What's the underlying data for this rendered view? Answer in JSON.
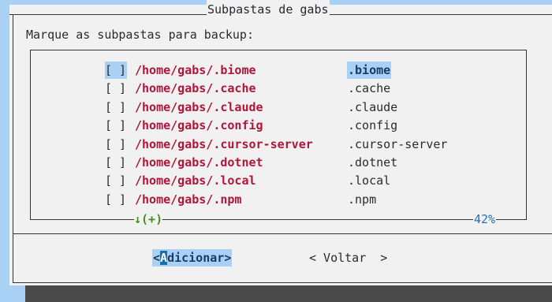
{
  "dialog": {
    "title": "Subpastas de gabs",
    "prompt": "Marque as subpastas para backup:",
    "more_indicator": "↓(+)",
    "scroll_percent": "42%"
  },
  "items": [
    {
      "check": "[ ]",
      "path": "/home/gabs/",
      "name": ".biome",
      "tag": ".biome",
      "highlighted": true
    },
    {
      "check": "[ ]",
      "path": "/home/gabs/",
      "name": ".cache",
      "tag": ".cache",
      "highlighted": false
    },
    {
      "check": "[ ]",
      "path": "/home/gabs/",
      "name": ".claude",
      "tag": ".claude",
      "highlighted": false
    },
    {
      "check": "[ ]",
      "path": "/home/gabs/",
      "name": ".config",
      "tag": ".config",
      "highlighted": false
    },
    {
      "check": "[ ]",
      "path": "/home/gabs/",
      "name": ".cursor-server",
      "tag": ".cursor-server",
      "highlighted": false
    },
    {
      "check": "[ ]",
      "path": "/home/gabs/",
      "name": ".dotnet",
      "tag": ".dotnet",
      "highlighted": false
    },
    {
      "check": "[ ]",
      "path": "/home/gabs/",
      "name": ".local",
      "tag": ".local",
      "highlighted": false
    },
    {
      "check": "[ ]",
      "path": "/home/gabs/",
      "name": ".npm",
      "tag": ".npm",
      "highlighted": false
    }
  ],
  "buttons": {
    "ok_open": "<",
    "ok_hotkey": "A",
    "ok_rest": "dicionar",
    "ok_close": ">",
    "back": "< Voltar  >"
  },
  "colors": {
    "background": "#a9d1f5",
    "dialog": "#f1f1f1",
    "path": "#b0163a",
    "highlight": "#a9d1f5",
    "more": "#4b8b1a",
    "percent": "#2c6fb2"
  }
}
